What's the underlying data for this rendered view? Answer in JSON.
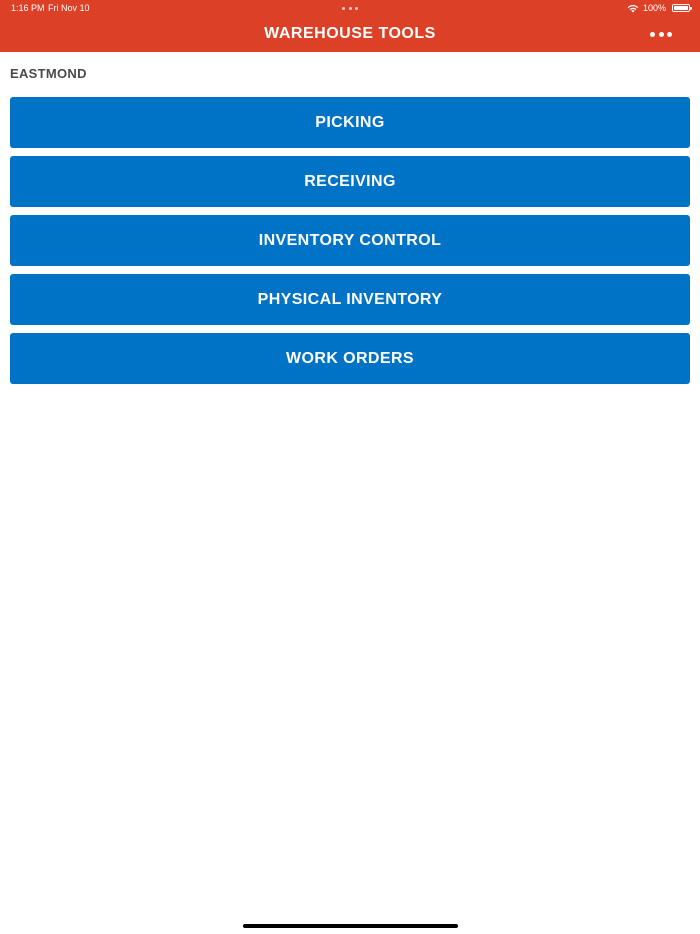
{
  "status_bar": {
    "time": "1:16 PM",
    "date": "Fri Nov 10",
    "battery": "100%"
  },
  "header": {
    "title": "WAREHOUSE TOOLS",
    "more_icon": "more-horizontal-icon"
  },
  "location": "EASTMOND",
  "menu": {
    "items": [
      {
        "label": "PICKING"
      },
      {
        "label": "RECEIVING"
      },
      {
        "label": "INVENTORY CONTROL"
      },
      {
        "label": "PHYSICAL INVENTORY"
      },
      {
        "label": "WORK ORDERS"
      }
    ]
  },
  "colors": {
    "header_bg": "#dc4128",
    "button_bg": "#0073c6",
    "location_text": "#4a4a4a"
  }
}
